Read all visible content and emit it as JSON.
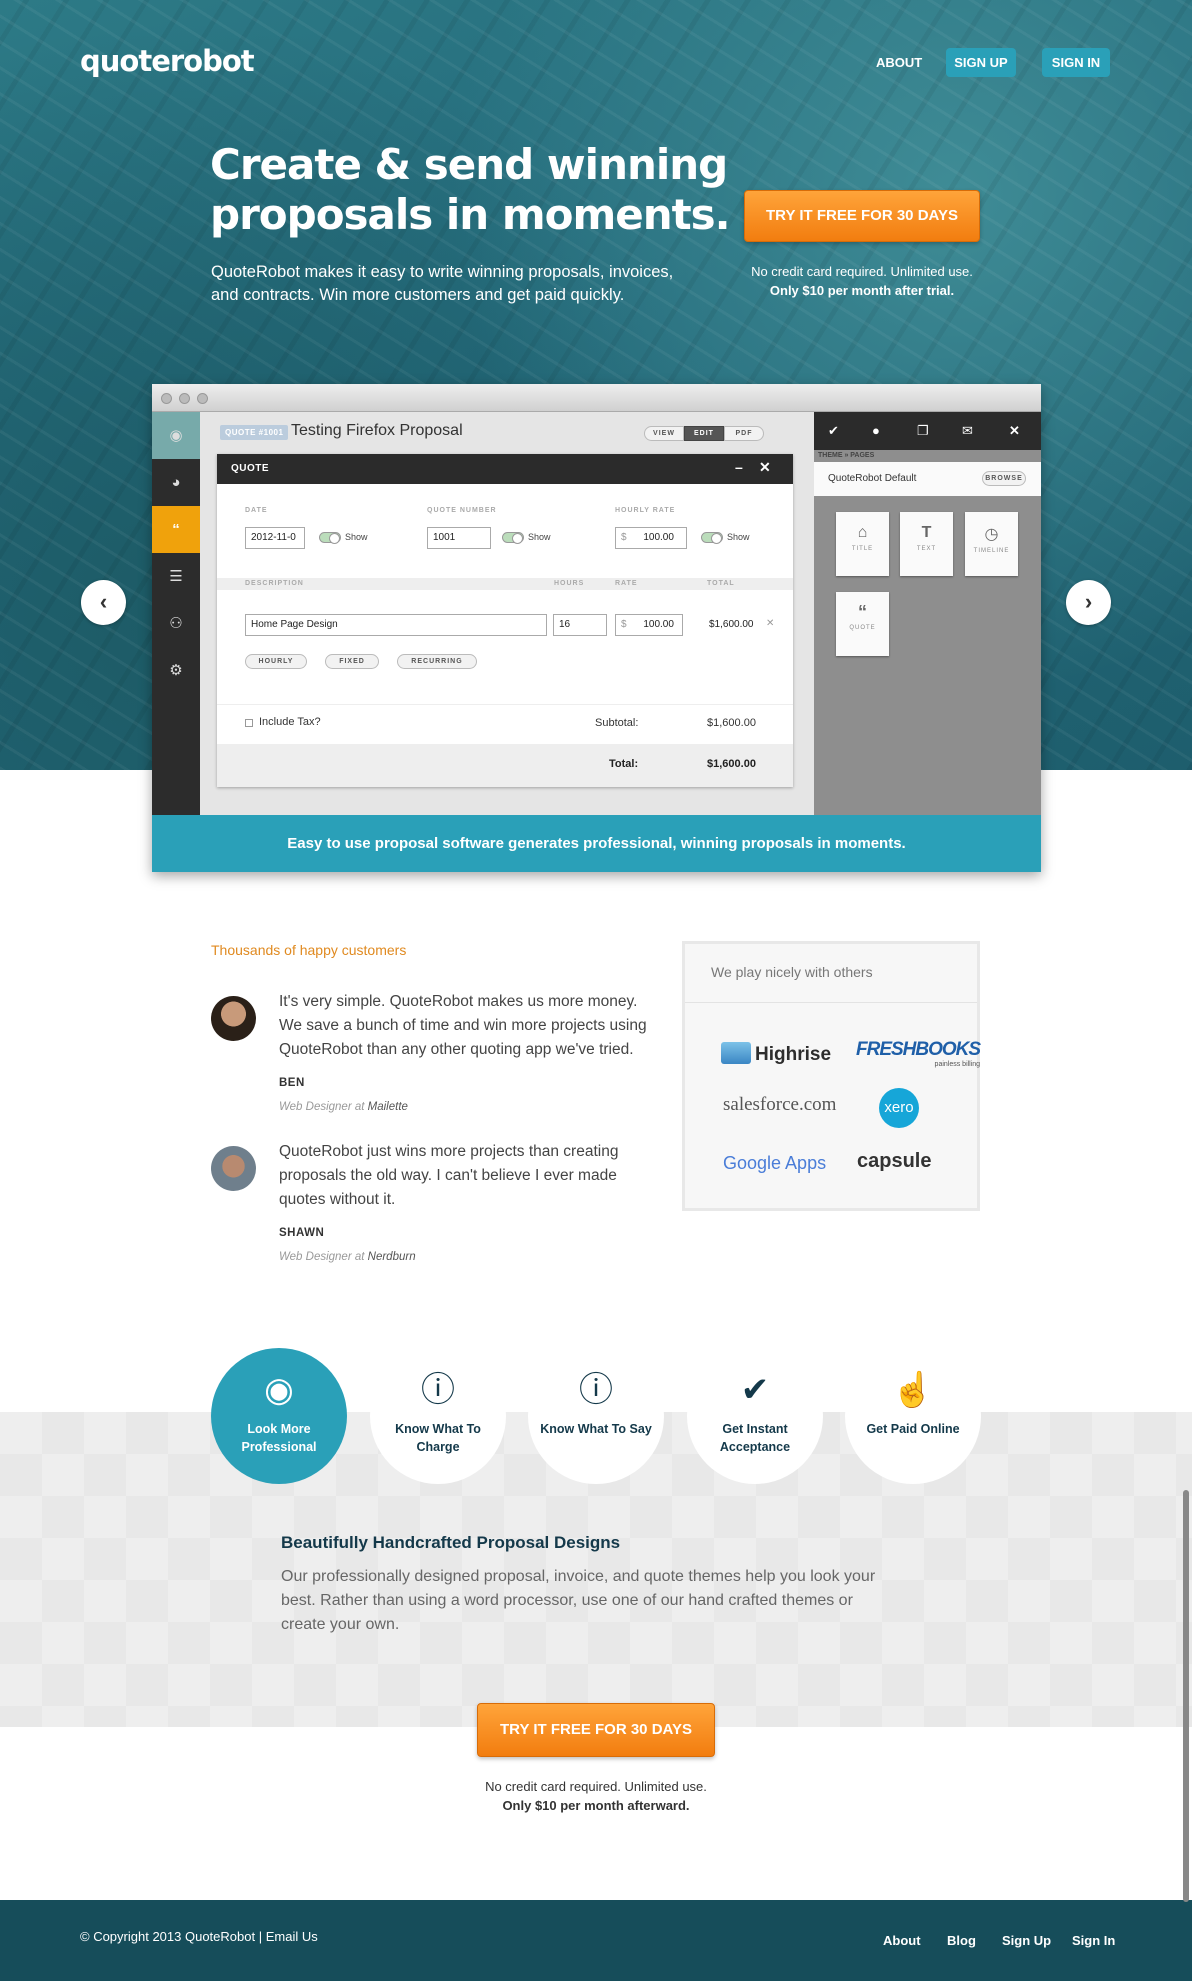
{
  "header": {
    "logo": "quoterobot",
    "nav": {
      "about": "ABOUT",
      "sign_up": "SIGN UP",
      "sign_in": "SIGN IN"
    }
  },
  "hero": {
    "title": "Create & send winning proposals in moments.",
    "subtitle": "QuoteRobot makes it easy to write winning proposals, invoices, and contracts. Win more customers and get paid quickly.",
    "cta": "TRY IT FREE FOR 30 DAYS",
    "note_line1": "No credit card required. Unlimited use.",
    "note_line2": "Only $10 per month after trial."
  },
  "slider": {
    "prev_icon": "chevron-left-icon",
    "next_icon": "chevron-right-icon",
    "caption": "Easy to use proposal software generates professional, winning proposals in moments."
  },
  "app": {
    "quote_badge": "QUOTE #1001",
    "quote_title": "Testing Firefox Proposal",
    "modes": {
      "view": "VIEW",
      "edit": "EDIT",
      "pdf": "PDF"
    },
    "panel_title": "QUOTE",
    "labels": {
      "date": "DATE",
      "quote_number": "QUOTE NUMBER",
      "hourly_rate": "HOURLY RATE",
      "show": "Show",
      "description": "DESCRIPTION",
      "hours": "HOURS",
      "rate": "RATE",
      "total": "TOTAL"
    },
    "values": {
      "date": "2012-11-0",
      "quote_number": "1001",
      "currency": "$",
      "hourly_rate": "100.00"
    },
    "line_item": {
      "description": "Home Page Design",
      "hours": "16",
      "rate": "100.00",
      "total": "$1,600.00"
    },
    "add_buttons": {
      "hourly": "HOURLY",
      "fixed": "FIXED",
      "recurring": "RECURRING"
    },
    "include_tax": "Include Tax?",
    "subtotal_label": "Subtotal:",
    "subtotal_value": "$1,600.00",
    "total_label": "Total:",
    "total_value": "$1,600.00",
    "theme": {
      "breadcrumb": "THEME » PAGES",
      "name": "QuoteRobot Default",
      "browse": "BROWSE"
    },
    "tiles": {
      "title": "TITLE",
      "text": "TEXT",
      "timeline": "TIMELINE",
      "quote": "QUOTE"
    }
  },
  "testimonials": {
    "title": "Thousands of happy customers",
    "items": [
      {
        "quote": "It's very simple. QuoteRobot makes us more money. We save a bunch of time and win more projects using QuoteRobot than any other quoting app we've tried.",
        "name": "BEN",
        "role": "Web Designer at",
        "company": "Mailette"
      },
      {
        "quote": "QuoteRobot just wins more projects than creating proposals the old way. I can't believe I ever made quotes without it.",
        "name": "SHAWN",
        "role": "Web Designer at",
        "company": "Nerdburn"
      }
    ]
  },
  "partners": {
    "title": "We play nicely with others",
    "logos": {
      "highrise": "Highrise",
      "freshbooks": "FRESHBOOKS",
      "freshbooks_tag": "painless billing",
      "salesforce": "salesforce.com",
      "xero": "xero",
      "google_apps": "Google Apps",
      "capsule": "capsule"
    }
  },
  "features": {
    "tabs": [
      {
        "label": "Look More Professional",
        "icon": "eye-icon"
      },
      {
        "label": "Know What To Charge",
        "icon": "info-icon"
      },
      {
        "label": "Know What To Say",
        "icon": "info-icon"
      },
      {
        "label": "Get Instant Acceptance",
        "icon": "check-icon"
      },
      {
        "label": "Get Paid Online",
        "icon": "thumbs-up-icon"
      }
    ],
    "active_title": "Beautifully Handcrafted Proposal Designs",
    "active_desc": "Our professionally designed proposal, invoice, and quote themes help you look your best. Rather than using a word processor, use one of our hand crafted themes or create your own."
  },
  "cta_bottom": {
    "button": "TRY IT FREE FOR 30 DAYS",
    "note_line1": "No credit card required. Unlimited use.",
    "note_line2": "Only $10 per month afterward."
  },
  "footer": {
    "copyright": "© Copyright 2013 QuoteRobot",
    "separator": "|",
    "email": "Email Us",
    "links": {
      "about": "About",
      "blog": "Blog",
      "sign_up": "Sign Up",
      "sign_in": "Sign In"
    }
  },
  "colors": {
    "teal": "#2aa0b8",
    "orange": "#f5901e",
    "navy": "#14394a",
    "footer": "#164d5a"
  }
}
